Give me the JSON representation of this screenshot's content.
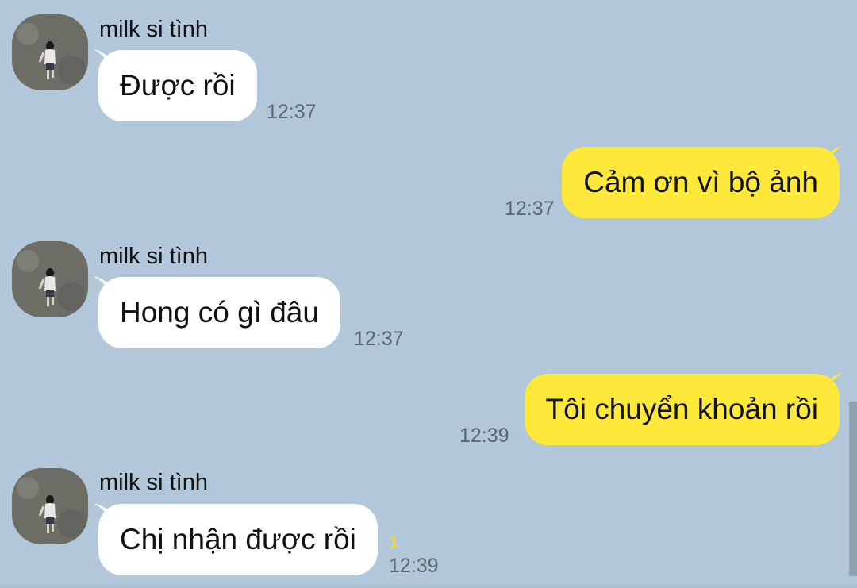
{
  "chat": {
    "messages": [
      {
        "direction": "in",
        "sender": "milk si tình",
        "text": "Được rồi",
        "time": "12:37"
      },
      {
        "direction": "out",
        "text": "Cảm ơn vì bộ ảnh",
        "time": "12:37"
      },
      {
        "direction": "in",
        "sender": "milk si tình",
        "text": "Hong có gì đâu",
        "time": "12:37"
      },
      {
        "direction": "out",
        "text": "Tôi chuyển khoản rồi",
        "time": "12:39"
      },
      {
        "direction": "in",
        "sender": "milk si tình",
        "text": "Chị nhận được rồi",
        "time": "12:39",
        "unread_count": "1"
      }
    ]
  },
  "colors": {
    "background": "#b2c7da",
    "incoming_bubble": "#ffffff",
    "outgoing_bubble": "#fee83a",
    "timestamp": "#5a6675",
    "unread": "#f6d52a"
  },
  "icons": {
    "avatar": "contact-photo"
  }
}
